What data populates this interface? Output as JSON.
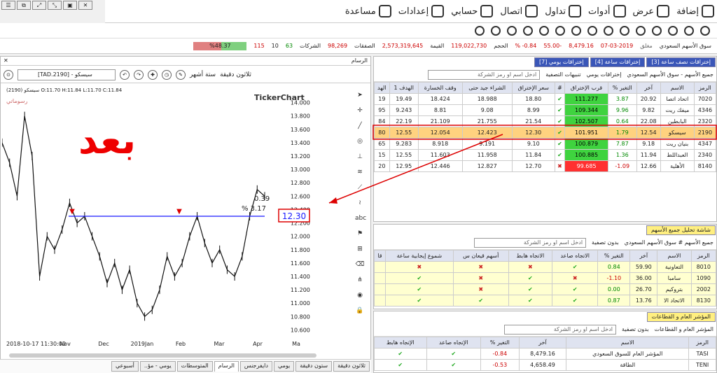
{
  "window_controls": [
    "☰",
    "⧉",
    "⤢",
    "⤡",
    "▣",
    "✕"
  ],
  "menu": {
    "items": [
      {
        "label": "إضافة",
        "icon": "add-icon"
      },
      {
        "label": "عرض",
        "icon": "view-icon"
      },
      {
        "label": "أدوات",
        "icon": "tools-icon"
      },
      {
        "label": "تداول",
        "icon": "trade-icon"
      },
      {
        "label": "اتصال",
        "icon": "connect-icon"
      },
      {
        "label": "حسابي",
        "icon": "account-icon"
      },
      {
        "label": "إعدادات",
        "icon": "settings-icon"
      },
      {
        "label": "مساعدة",
        "icon": "help-icon"
      }
    ]
  },
  "market": {
    "name": "سوق الأسهم السعودي",
    "status": "مغلق",
    "date": "07-03-2019",
    "index": "8,479.16",
    "change": "-55.00",
    "change_pct": "0.84- %",
    "volume_label": "الحجم",
    "volume": "119,022,730",
    "value_label": "القيمة",
    "value": "2,573,319,645",
    "deals_label": "الصفقات",
    "deals": "98,269",
    "companies_label": "الشركات",
    "up": "63",
    "flat": "10",
    "down": "115",
    "ratio": "%48.37"
  },
  "chart": {
    "panel_title": "الرسام",
    "close": "✕",
    "period": "ثلاثون دقيقة",
    "range": "ستة أشهر",
    "symbol": "[TAD.2190] - سيسكو",
    "info": "(2190) سيسكو O:11.70 H:11.84 L:11.70 C:11.84",
    "brand": "TickerChart",
    "watermark": "بعد",
    "drawings_label": "رسوماتي",
    "price_label": "12.30",
    "diff_value": "0.39",
    "diff_pct": "% 3.17",
    "bottom_date": "2018-10-17 11:30:00",
    "tabs": [
      "ثلاثون دقيقة",
      "ستون دقيقة",
      "يومي",
      "دايفرجنس",
      "الرسام",
      "المتوسطات",
      "يومي - مؤ..",
      "أسبوعي"
    ],
    "active_tab": "الرسام"
  },
  "chart_data": {
    "type": "line",
    "title": "",
    "xlabel": "",
    "ylabel": "",
    "ylim": [
      10.5,
      14.1
    ],
    "yticks": [
      "14.0000",
      "13.8000",
      "13.6000",
      "13.4000",
      "13.2000",
      "13.0000",
      "12.8000",
      "12.6000",
      "12.4000",
      "12.2000",
      "12.0000",
      "11.8000",
      "11.6000",
      "11.4000",
      "11.2000",
      "11.0000",
      "10.8000",
      "10.6000"
    ],
    "xticks": [
      "Nov",
      "Dec",
      "2019Jan",
      "Feb",
      "Mar",
      "Apr",
      "Ma"
    ],
    "support_level": 12.3,
    "series": [
      {
        "values": [
          13.4,
          13.1,
          12.6,
          13.8,
          13.2,
          11.4,
          12.0,
          11.8,
          12.1,
          12.5,
          12.2,
          12.3,
          12.0,
          11.7,
          11.3,
          11.6,
          11.2,
          11.5,
          11.0,
          10.8,
          10.9,
          11.2,
          11.7,
          11.4,
          11.6,
          12.0,
          12.3,
          11.9,
          11.6,
          11.8,
          11.5,
          11.4,
          11.7,
          12.3,
          12.7,
          12.6
        ]
      }
    ]
  },
  "topgrid": {
    "tabs": [
      "إختراقات نصف ساعة [3]",
      "إختراقات ساعة [4]",
      "إختراقات يومي [7]"
    ],
    "filter": "جميع الأسهم - سوق الأسهم السعودي",
    "subfilter": "إختراقات يومي",
    "alerts": "تنبيهات التصفية",
    "search": "ادخل اسم او رمز الشركة",
    "headers": [
      "الرمز",
      "الاسم",
      "آخر",
      "التغير %",
      "قرب الإختراق",
      "#",
      "سعر الإختراق",
      "الشراء جيد حتى",
      "وقف الخسارة",
      "الهدف 1",
      "الهد"
    ],
    "rows": [
      {
        "code": "7020",
        "name": "اتحاد اتصا",
        "last": "20.92",
        "chg": "3.87",
        "near": "111.277",
        "ok": true,
        "bp": "18.80",
        "good": "18.988",
        "stop": "18.424",
        "t1": "19.49",
        "t2": "19"
      },
      {
        "code": "4346",
        "name": "ميفك ريت",
        "last": "9.82",
        "chg": "9.96",
        "near": "109.344",
        "ok": true,
        "bp": "8.99",
        "good": "9.08",
        "stop": "8.81",
        "t1": "9.243",
        "t2": "95"
      },
      {
        "code": "2320",
        "name": "البابطين",
        "last": "22.08",
        "chg": "0.64",
        "near": "102.507",
        "ok": true,
        "bp": "21.54",
        "good": "21.755",
        "stop": "21.109",
        "t1": "22.19",
        "t2": "84"
      },
      {
        "code": "2190",
        "name": "سيسكو",
        "last": "12.54",
        "chg": "1.79",
        "near": "101.951",
        "ok": true,
        "bp": "12.30",
        "good": "12.423",
        "stop": "12.054",
        "t1": "12.55",
        "t2": "80",
        "sel": true
      },
      {
        "code": "4347",
        "name": "بنيان ريت",
        "last": "9.18",
        "chg": "7.87",
        "near": "100.879",
        "ok": true,
        "bp": "9.10",
        "good": "9.191",
        "stop": "8.918",
        "t1": "9.283",
        "t2": "65"
      },
      {
        "code": "2340",
        "name": "العبداللط",
        "last": "11.94",
        "chg": "1.36",
        "near": "100.885",
        "ok": true,
        "bp": "11.84",
        "good": "11.958",
        "stop": "11.603",
        "t1": "12.55",
        "t2": "15"
      },
      {
        "code": "8140",
        "name": "الأهلية",
        "last": "12.66",
        "chg": "1.09-",
        "near": "99.685",
        "ok": false,
        "bp": "12.70",
        "good": "12.827",
        "stop": "12.446",
        "t1": "12.95",
        "t2": "20"
      }
    ]
  },
  "midgrid": {
    "title": "شاشة تحليل جميع الأسهم",
    "filter": "جميع الأسهم # سوق الأسهم السعودي",
    "nofilter": "بدون تصفية",
    "search": "ادخل اسم او رمز الشركة",
    "headers": [
      "الرمز",
      "الاسم",
      "آخر",
      "التغير %",
      "الاتجاه صاعد",
      "الاتجاه هابط",
      "أسهم قيعان س",
      "شموع إيجابية ساعة",
      "قا"
    ],
    "rows": [
      {
        "code": "8010",
        "name": "التعاونية",
        "last": "59.90",
        "chg": "0.84",
        "up": "✔",
        "down": "✖",
        "a": "✖",
        "b": "✖"
      },
      {
        "code": "1090",
        "name": "سامبا",
        "last": "36.00",
        "chg": "1.10-",
        "up": "✖",
        "down": "✔",
        "a": "✖",
        "b": "✔"
      },
      {
        "code": "2002",
        "name": "بتروكيم",
        "last": "26.70",
        "chg": "0.00",
        "up": "✔",
        "down": "✔",
        "a": "✖",
        "b": "✔"
      },
      {
        "code": "8130",
        "name": "الاتحاد الا",
        "last": "13.76",
        "chg": "0.87",
        "up": "✔",
        "down": "✔",
        "a": "✔",
        "b": "✔"
      }
    ]
  },
  "botgrid": {
    "title": "المؤشر العام و القطاعات",
    "filter": "المؤشر العام و القطاعات",
    "nofilter": "بدون تصفية",
    "search": "ادخل اسم او رمز الشركة",
    "headers": [
      "الرمز",
      "الاسم",
      "آخر",
      "التغير %",
      "الإتجاه صاعد",
      "الإتجاه هابط"
    ],
    "rows": [
      {
        "code": "TASI",
        "name": "المؤشر العام للسوق السعودي",
        "last": "8,479.16",
        "chg": "0.84-",
        "up": "✔",
        "down": "✔"
      },
      {
        "code": "TENI",
        "name": "الطاقة",
        "last": "4,658.49",
        "chg": "0.53-",
        "up": "✔",
        "down": "✔"
      }
    ]
  }
}
